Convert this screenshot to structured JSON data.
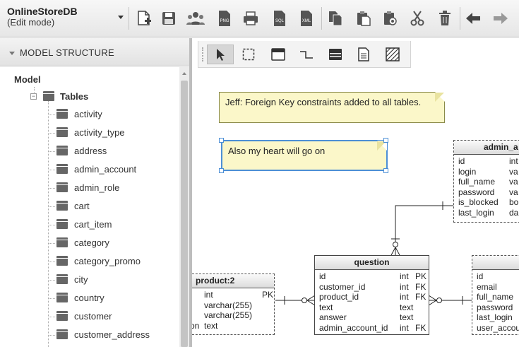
{
  "app": {
    "title": "OnlineStoreDB",
    "mode": "(Edit mode)"
  },
  "toolbar": {
    "buttons": [
      "new-document",
      "save",
      "users",
      "export-png",
      "print",
      "export-sql",
      "export-xml",
      "copy",
      "paste",
      "paste-special",
      "cut",
      "delete",
      "back",
      "forward"
    ],
    "file_labels": {
      "png": "PNG",
      "sql": "SQL",
      "xml": "XML"
    }
  },
  "sidebar": {
    "title": "MODEL STRUCTURE",
    "root": "Model",
    "group": "Tables",
    "items": [
      "activity",
      "activity_type",
      "address",
      "admin_account",
      "admin_role",
      "cart",
      "cart_item",
      "category",
      "category_promo",
      "city",
      "country",
      "customer",
      "customer_address"
    ]
  },
  "palette": {
    "tools": [
      "select-tool",
      "rectangle-select-tool",
      "table-tool",
      "relation-tool",
      "view-tool",
      "note-tool",
      "area-tool"
    ]
  },
  "notes": [
    {
      "text": "Jeff: Foreign Key constraints added to all tables."
    },
    {
      "text": "Also my heart will go on"
    }
  ],
  "entities": {
    "question": {
      "title": "question",
      "columns": [
        {
          "name": "id",
          "type": "int",
          "key": "PK"
        },
        {
          "name": "customer_id",
          "type": "int",
          "key": "FK"
        },
        {
          "name": "product_id",
          "type": "int",
          "key": "FK"
        },
        {
          "name": "text",
          "type": "text",
          "key": ""
        },
        {
          "name": "answer",
          "type": "text",
          "key": ""
        },
        {
          "name": "admin_account_id",
          "type": "int",
          "key": "FK"
        }
      ]
    },
    "product": {
      "title": "product:2",
      "columns": [
        {
          "name": "",
          "type": "int",
          "key": "PK"
        },
        {
          "name": "",
          "type": "varchar(255)",
          "key": ""
        },
        {
          "name": "",
          "type": "varchar(255)",
          "key": ""
        },
        {
          "name": "on",
          "type": "text",
          "key": ""
        }
      ]
    },
    "admin_account": {
      "title": "admin_a",
      "columns": [
        {
          "name": "id",
          "type": "int"
        },
        {
          "name": "login",
          "type": "va"
        },
        {
          "name": "full_name",
          "type": "va"
        },
        {
          "name": "password",
          "type": "va"
        },
        {
          "name": "is_blocked",
          "type": "bo"
        },
        {
          "name": "last_login",
          "type": "da"
        }
      ]
    },
    "customer": {
      "title": "",
      "columns": [
        {
          "name": "id"
        },
        {
          "name": "email"
        },
        {
          "name": "full_name"
        },
        {
          "name": "password"
        },
        {
          "name": "last_login"
        },
        {
          "name": "user_accou"
        }
      ]
    }
  },
  "colors": {
    "note_fill": "#fbf7c9",
    "selection": "#4c8fd6",
    "toolbar_bg": "#ececec"
  }
}
